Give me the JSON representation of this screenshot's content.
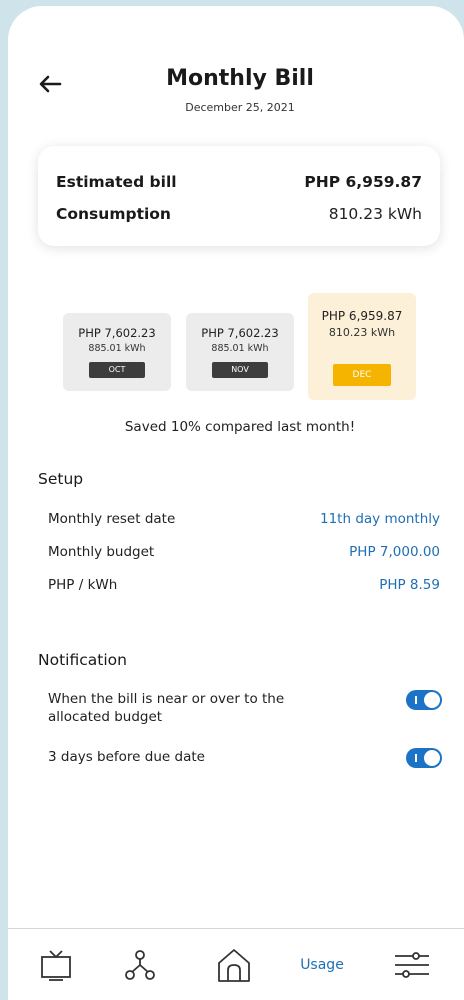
{
  "header": {
    "title": "Monthly Bill",
    "date": "December 25, 2021"
  },
  "summary": {
    "estimated_label": "Estimated bill",
    "estimated_value": "PHP 6,959.87",
    "consumption_label": "Consumption",
    "consumption_value": "810.23 kWh"
  },
  "months": [
    {
      "amount": "PHP 7,602.23",
      "kwh": "885.01 kWh",
      "label": "OCT"
    },
    {
      "amount": "PHP 7,602.23",
      "kwh": "885.01 kWh",
      "label": "NOV"
    },
    {
      "amount": "PHP 6,959.87",
      "kwh": "810.23 kWh",
      "label": "DEC"
    }
  ],
  "saved_message": "Saved 10% compared last month!",
  "setup": {
    "title": "Setup",
    "rows": [
      {
        "label": "Monthly reset date",
        "value": "11th day monthly"
      },
      {
        "label": "Monthly budget",
        "value": "PHP 7,000.00"
      },
      {
        "label": "PHP / kWh",
        "value": "PHP 8.59"
      }
    ]
  },
  "notification": {
    "title": "Notification",
    "rows": [
      {
        "label": "When the bill is near or over to the allocated budget",
        "enabled": true
      },
      {
        "label": "3 days before due date",
        "enabled": true
      }
    ]
  },
  "tabbar": {
    "items": [
      {
        "icon": "tv-icon"
      },
      {
        "icon": "network-icon"
      },
      {
        "icon": "home-icon"
      },
      {
        "label": "Usage"
      },
      {
        "icon": "sliders-icon"
      }
    ]
  },
  "colors": {
    "accent": "#1f6fb5",
    "toggle": "#1a73c7",
    "current_month_bg": "#fdf0d8",
    "current_month_tag": "#f5b400",
    "background": "#cfe3ea"
  }
}
